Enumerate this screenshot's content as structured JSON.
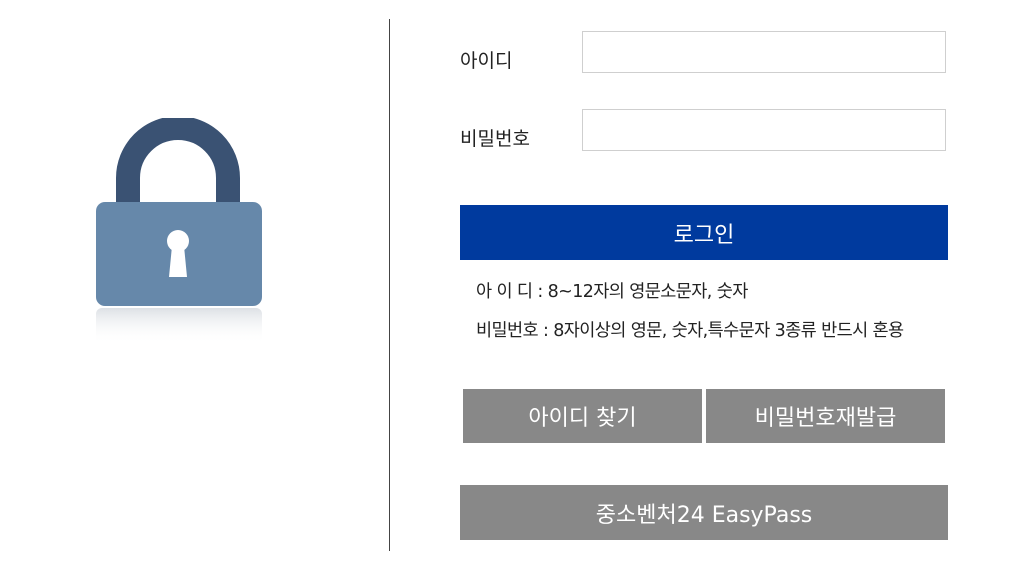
{
  "login_form": {
    "id_label": "아이디",
    "id_value": "",
    "password_label": "비밀번호",
    "password_value": "",
    "login_button": "로그인"
  },
  "rules": {
    "id_rule": "아 이 디 : 8~12자의 영문소문자, 숫자",
    "password_rule": "비밀번호 : 8자이상의 영문, 숫자,특수문자 3종류 반드시 혼용"
  },
  "actions": {
    "find_id": "아이디 찾기",
    "reissue_password": "비밀번호재발급",
    "easypass": "중소벤처24 EasyPass"
  },
  "icons": {
    "lock": "lock-icon"
  },
  "colors": {
    "primary_button": "#003a9e",
    "secondary_button": "#888888",
    "lock_body": "#6688aa",
    "lock_shackle": "#3a5273"
  }
}
